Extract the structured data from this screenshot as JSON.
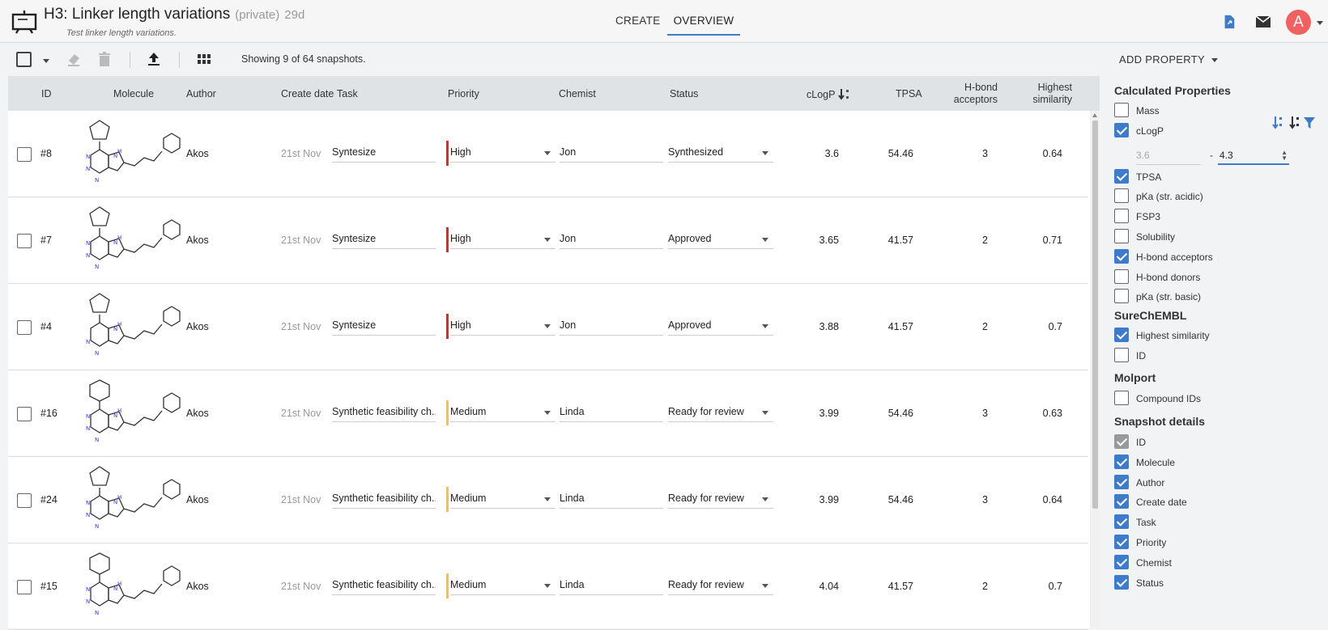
{
  "header": {
    "title": "H3: Linker length variations",
    "privacy": "(private)",
    "age": "29d",
    "subtitle": "Test linker length variations.",
    "tabs": [
      "CREATE",
      "OVERVIEW"
    ],
    "avatar_letter": "A",
    "icons": [
      "presentation-board-icon",
      "share-icon",
      "mail-icon"
    ]
  },
  "toolbar": {
    "showing": "Showing 9 of 64 snapshots.",
    "icons": [
      "select-all-checkbox",
      "eraser-icon",
      "trash-icon",
      "upload-icon",
      "grid-icon"
    ]
  },
  "table": {
    "columns": {
      "id": "ID",
      "molecule": "Molecule",
      "author": "Author",
      "create_date": "Create date",
      "task": "Task",
      "priority": "Priority",
      "chemist": "Chemist",
      "status": "Status",
      "clogp": "cLogP",
      "tpsa": "TPSA",
      "hba_1": "H-bond",
      "hba_2": "acceptors",
      "sim_1": "Highest",
      "sim_2": "similarity"
    },
    "rows": [
      {
        "id": "#8",
        "author": "Akos",
        "date": "21st Nov",
        "task": "Syntesize",
        "priority": "High",
        "chemist": "Jon",
        "status": "Synthesized",
        "clogp": "3.6",
        "tpsa": "54.46",
        "hba": "3",
        "sim": "0.64"
      },
      {
        "id": "#7",
        "author": "Akos",
        "date": "21st Nov",
        "task": "Syntesize",
        "priority": "High",
        "chemist": "Jon",
        "status": "Approved",
        "clogp": "3.65",
        "tpsa": "41.57",
        "hba": "2",
        "sim": "0.71"
      },
      {
        "id": "#4",
        "author": "Akos",
        "date": "21st Nov",
        "task": "Syntesize",
        "priority": "High",
        "chemist": "Jon",
        "status": "Approved",
        "clogp": "3.88",
        "tpsa": "41.57",
        "hba": "2",
        "sim": "0.7"
      },
      {
        "id": "#16",
        "author": "Akos",
        "date": "21st Nov",
        "task": "Synthetic feasibility ch...",
        "priority": "Medium",
        "chemist": "Linda",
        "status": "Ready for review",
        "clogp": "3.99",
        "tpsa": "54.46",
        "hba": "3",
        "sim": "0.63"
      },
      {
        "id": "#24",
        "author": "Akos",
        "date": "21st Nov",
        "task": "Synthetic feasibility ch...",
        "priority": "Medium",
        "chemist": "Linda",
        "status": "Ready for review",
        "clogp": "3.99",
        "tpsa": "54.46",
        "hba": "3",
        "sim": "0.64"
      },
      {
        "id": "#15",
        "author": "Akos",
        "date": "21st Nov",
        "task": "Synthetic feasibility ch...",
        "priority": "Medium",
        "chemist": "Linda",
        "status": "Ready for review",
        "clogp": "4.04",
        "tpsa": "41.57",
        "hba": "2",
        "sim": "0.7"
      }
    ]
  },
  "colors": {
    "accent": "#3e7bc8",
    "priority_high": "#e0262f",
    "priority_medium": "#f5c242",
    "avatar": "#f06262"
  },
  "panel": {
    "add_property": "ADD PROPERTY",
    "clogp_range_min": "3.6",
    "clogp_range_max": "4.3",
    "range_separator": "-",
    "sections": [
      {
        "title": "Calculated Properties",
        "items": [
          {
            "label": "Mass",
            "checked": false
          },
          {
            "label": "cLogP",
            "checked": true
          },
          {
            "label": "TPSA",
            "checked": true
          },
          {
            "label": "pKa (str. acidic)",
            "checked": false
          },
          {
            "label": "FSP3",
            "checked": false
          },
          {
            "label": "Solubility",
            "checked": false
          },
          {
            "label": "H-bond acceptors",
            "checked": true
          },
          {
            "label": "H-bond donors",
            "checked": false
          },
          {
            "label": "pKa (str. basic)",
            "checked": false
          }
        ]
      },
      {
        "title": "SureChEMBL",
        "items": [
          {
            "label": "Highest similarity",
            "checked": true
          },
          {
            "label": "ID",
            "checked": false
          }
        ]
      },
      {
        "title": "Molport",
        "items": [
          {
            "label": "Compound IDs",
            "checked": false
          }
        ]
      },
      {
        "title": "Snapshot details",
        "items": [
          {
            "label": "ID",
            "checked": true,
            "disabled": true
          },
          {
            "label": "Molecule",
            "checked": true
          },
          {
            "label": "Author",
            "checked": true
          },
          {
            "label": "Create date",
            "checked": true
          },
          {
            "label": "Task",
            "checked": true
          },
          {
            "label": "Priority",
            "checked": true
          },
          {
            "label": "Chemist",
            "checked": true
          },
          {
            "label": "Status",
            "checked": true
          }
        ]
      }
    ]
  }
}
